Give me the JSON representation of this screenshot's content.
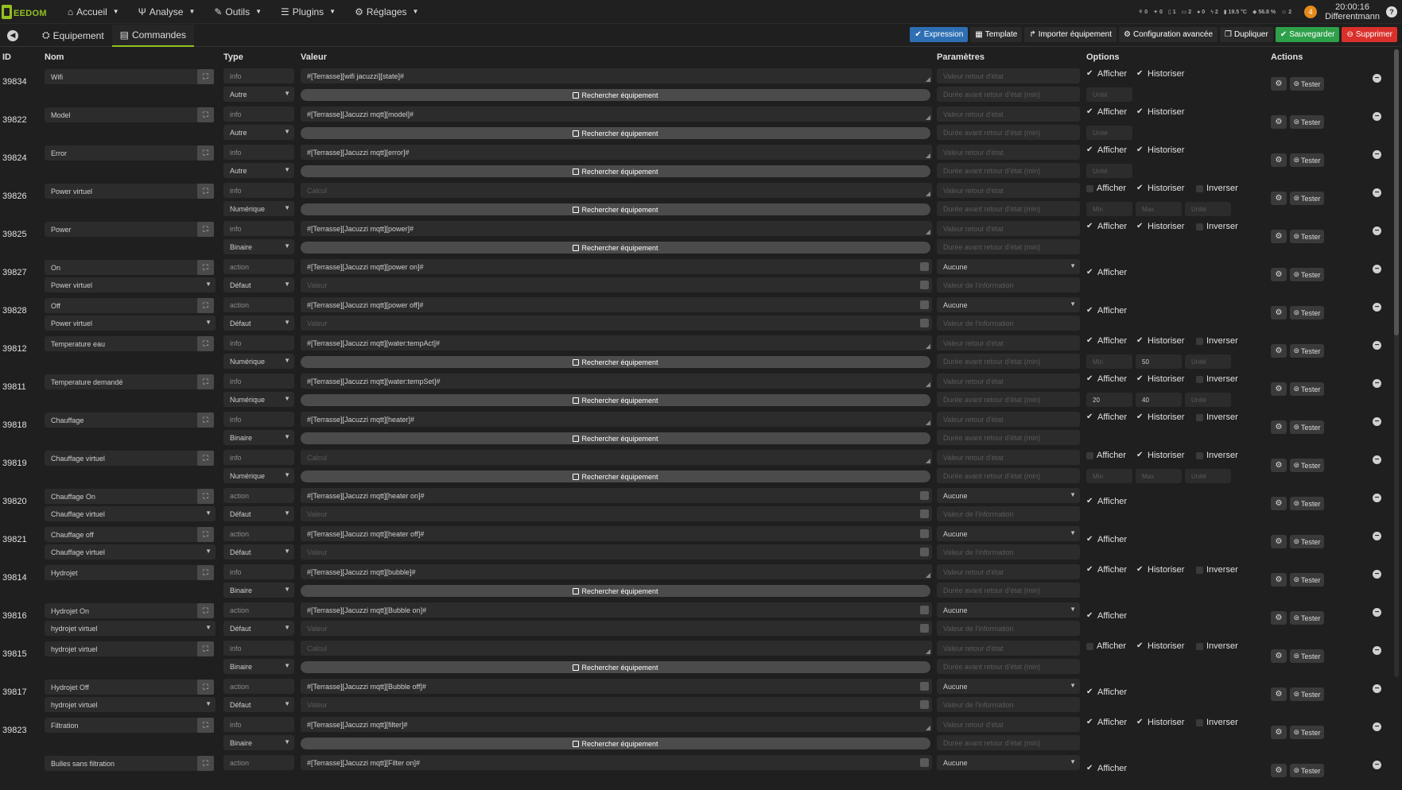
{
  "brand": {
    "logo_text": "EEDOM"
  },
  "nav": [
    {
      "label": "Accueil",
      "icon": "home-icon"
    },
    {
      "label": "Analyse",
      "icon": "analyse-icon"
    },
    {
      "label": "Outils",
      "icon": "wrench-icon"
    },
    {
      "label": "Plugins",
      "icon": "list-icon"
    },
    {
      "label": "Réglages",
      "icon": "gear-icon"
    }
  ],
  "status_bar": {
    "items": [
      "0",
      "0",
      "1",
      "2",
      "0",
      "2",
      "19.5 °C",
      "56.8 %",
      "2"
    ],
    "notif_count": "4",
    "time": "20:00:16",
    "user": "Differentmann"
  },
  "tabs": {
    "equipement": "Equipement",
    "commandes": "Commandes"
  },
  "actions": {
    "expression": "Expression",
    "template": "Template",
    "import": "Importer équipement",
    "config": "Configuration avancée",
    "duplicate": "Dupliquer",
    "save": "Sauvegarder",
    "delete": "Supprimer"
  },
  "colors": {
    "accent": "#94c11f",
    "blue": "#2e6fb4",
    "green": "#2ea04a",
    "red": "#d9302b",
    "background": "#1f1f1f"
  },
  "columns": {
    "id": "ID",
    "name": "Nom",
    "type": "Type",
    "value": "Valeur",
    "params": "Paramètres",
    "options": "Options",
    "actions": "Actions"
  },
  "labels": {
    "search_equipment": "Rechercher équipement",
    "show": "Afficher",
    "history": "Historiser",
    "invert": "Inverser",
    "test": "Tester",
    "ph_return_state": "Valeur retour d'état",
    "ph_duration": "Durée avant retour d'état (min)",
    "ph_unit": "Unité",
    "ph_min": "Min",
    "ph_max": "Max",
    "ph_calc": "Calcul",
    "ph_value": "Valeur",
    "ph_info_value": "Valeur de l'information"
  },
  "commands": [
    {
      "id": "39834",
      "name": "Wifi",
      "type": "info",
      "subtype": "Autre",
      "value": "#[Terrasse][wifi jacuzzi][state]#",
      "show": true,
      "history": true
    },
    {
      "id": "39822",
      "name": "Model",
      "type": "info",
      "subtype": "Autre",
      "value": "#[Terrasse][Jacuzzi mqtt][model]#",
      "show": true,
      "history": true
    },
    {
      "id": "39824",
      "name": "Error",
      "type": "info",
      "subtype": "Autre",
      "value": "#[Terrasse][Jacuzzi mqtt][error]#",
      "show": true,
      "history": true
    },
    {
      "id": "39826",
      "name": "Power virtuel",
      "type": "info",
      "subtype": "Numérique",
      "value": "",
      "show": false,
      "history": true,
      "invert": false,
      "min": "",
      "max": ""
    },
    {
      "id": "39825",
      "name": "Power",
      "type": "info",
      "subtype": "Binaire",
      "value": "#[Terrasse][Jacuzzi mqtt][power]#",
      "show": true,
      "history": true,
      "invert": false
    },
    {
      "id": "39827",
      "name": "On",
      "type": "action",
      "subtype": "Défaut",
      "link": "Power virtuel",
      "value": "#[Terrasse][Jacuzzi mqtt][power on]#",
      "param": "Aucune",
      "show": true
    },
    {
      "id": "39828",
      "name": "Off",
      "type": "action",
      "subtype": "Défaut",
      "link": "Power virtuel",
      "value": "#[Terrasse][Jacuzzi mqtt][power off]#",
      "param": "Aucune",
      "show": true
    },
    {
      "id": "39812",
      "name": "Temperature eau",
      "type": "info",
      "subtype": "Numérique",
      "value": "#[Terrasse][Jacuzzi mqtt][water:tempAct]#",
      "show": true,
      "history": true,
      "invert": false,
      "min": "",
      "max": "50"
    },
    {
      "id": "39811",
      "name": "Temperature demandé",
      "type": "info",
      "subtype": "Numérique",
      "value": "#[Terrasse][Jacuzzi mqtt][water:tempSet]#",
      "show": true,
      "history": true,
      "invert": false,
      "min": "20",
      "max": "40"
    },
    {
      "id": "39818",
      "name": "Chauffage",
      "type": "info",
      "subtype": "Binaire",
      "value": "#[Terrasse][Jacuzzi mqtt][heater]#",
      "show": true,
      "history": true,
      "invert": false
    },
    {
      "id": "39819",
      "name": "Chauffage virtuel",
      "type": "info",
      "subtype": "Numérique",
      "value": "",
      "show": false,
      "history": true,
      "invert": false,
      "min": "",
      "max": ""
    },
    {
      "id": "39820",
      "name": "Chauffage On",
      "type": "action",
      "subtype": "Défaut",
      "link": "Chauffage virtuel",
      "value": "#[Terrasse][Jacuzzi mqtt][heater on]#",
      "param": "Aucune",
      "show": true
    },
    {
      "id": "39821",
      "name": "Chauffage off",
      "type": "action",
      "subtype": "Défaut",
      "link": "Chauffage virtuel",
      "value": "#[Terrasse][Jacuzzi mqtt][heater off]#",
      "param": "Aucune",
      "show": true
    },
    {
      "id": "39814",
      "name": "Hydrojet",
      "type": "info",
      "subtype": "Binaire",
      "value": "#[Terrasse][Jacuzzi mqtt][bubble]#",
      "show": true,
      "history": true,
      "invert": false
    },
    {
      "id": "39816",
      "name": "Hydrojet On",
      "type": "action",
      "subtype": "Défaut",
      "link": "hydrojet virtuel",
      "value": "#[Terrasse][Jacuzzi mqtt][Bubble on]#",
      "param": "Aucune",
      "show": true
    },
    {
      "id": "39815",
      "name": "hydrojet virtuel",
      "type": "info",
      "subtype": "Binaire",
      "value": "",
      "show": false,
      "history": true,
      "invert": false
    },
    {
      "id": "39817",
      "name": "Hydrojet Off",
      "type": "action",
      "subtype": "Défaut",
      "link": "hydrojet virtuel",
      "value": "#[Terrasse][Jacuzzi mqtt][Bubble off]#",
      "param": "Aucune",
      "show": true
    },
    {
      "id": "39823",
      "name": "Filtration",
      "type": "info",
      "subtype": "Binaire",
      "value": "#[Terrasse][Jacuzzi mqtt][filter]#",
      "show": true,
      "history": true,
      "invert": false
    },
    {
      "id": "",
      "name": "Bulles sans filtration",
      "type": "action",
      "subtype": "",
      "value": "#[Terrasse][Jacuzzi mqtt][Filter on]#",
      "param": "Aucune",
      "show": true
    }
  ]
}
